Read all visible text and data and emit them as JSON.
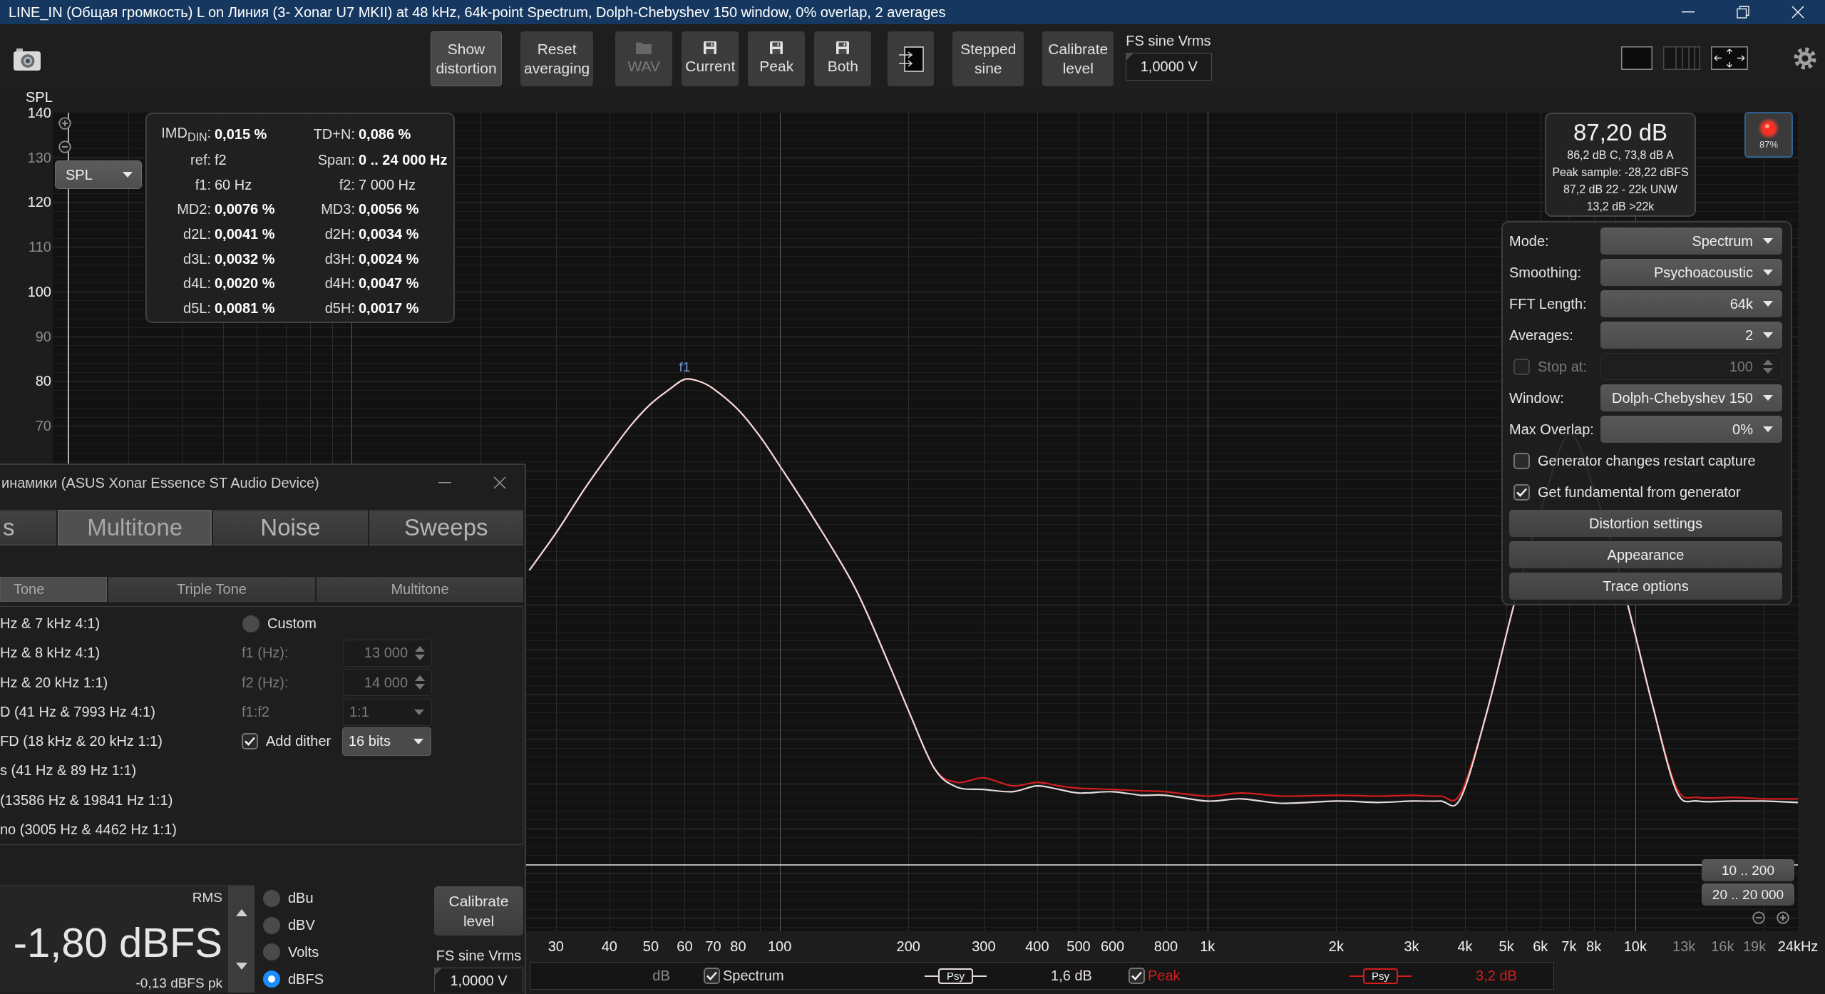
{
  "window": {
    "title": "LINE_IN (Общая громкость) L on Линия (3- Xonar U7 MKII) at 48 kHz, 64k-point Spectrum, Dolph-Chebyshev 150 window, 0% overlap, 2 averages"
  },
  "toolbar": {
    "buttons": [
      {
        "label": "Show distortion",
        "kind": "text",
        "on": true,
        "disabled": false
      },
      {
        "label": "Reset averaging",
        "kind": "text",
        "on": false,
        "disabled": false
      },
      {
        "label": "WAV",
        "kind": "open",
        "on": false,
        "disabled": true
      },
      {
        "label": "Current",
        "kind": "save",
        "on": false,
        "disabled": false
      },
      {
        "label": "Peak",
        "kind": "save",
        "on": false,
        "disabled": false
      },
      {
        "label": "Both",
        "kind": "save",
        "on": false,
        "disabled": false
      },
      {
        "kind": "import",
        "on": false,
        "disabled": false
      },
      {
        "label": "Stepped sine",
        "kind": "text",
        "on": false,
        "disabled": false
      },
      {
        "label": "Calibrate level",
        "kind": "text",
        "on": false,
        "disabled": false
      }
    ],
    "fs_sine": {
      "label": "FS sine Vrms",
      "value": "1,0000 V"
    }
  },
  "graph": {
    "y_axis": {
      "title": "SPL",
      "labels": [
        {
          "text": "140",
          "dim": false
        },
        {
          "text": "130",
          "dim": true
        },
        {
          "text": "120",
          "dim": false
        },
        {
          "text": "110",
          "dim": true
        },
        {
          "text": "100",
          "dim": false
        },
        {
          "text": "90",
          "dim": true
        },
        {
          "text": "80",
          "dim": false
        },
        {
          "text": "70",
          "dim": true
        }
      ]
    },
    "unit_dropdown": {
      "value": "SPL"
    },
    "peak_marker": {
      "label": "f1"
    },
    "x_axis": {
      "labels": [
        {
          "text": "30",
          "dim": false
        },
        {
          "text": "40",
          "dim": false
        },
        {
          "text": "50",
          "dim": false
        },
        {
          "text": "60",
          "dim": false
        },
        {
          "text": "70",
          "dim": false
        },
        {
          "text": "80",
          "dim": false
        },
        {
          "text": "100",
          "dim": false
        },
        {
          "text": "200",
          "dim": false
        },
        {
          "text": "300",
          "dim": false
        },
        {
          "text": "400",
          "dim": false
        },
        {
          "text": "500",
          "dim": false
        },
        {
          "text": "600",
          "dim": false
        },
        {
          "text": "800",
          "dim": false
        },
        {
          "text": "1k",
          "dim": false
        },
        {
          "text": "2k",
          "dim": false
        },
        {
          "text": "3k",
          "dim": false
        },
        {
          "text": "4k",
          "dim": false
        },
        {
          "text": "5k",
          "dim": false
        },
        {
          "text": "6k",
          "dim": false
        },
        {
          "text": "7k",
          "dim": false
        },
        {
          "text": "8k",
          "dim": false
        },
        {
          "text": "10k",
          "dim": false
        },
        {
          "text": "13k",
          "dim": true
        },
        {
          "text": "16k",
          "dim": true
        },
        {
          "text": "19k",
          "dim": true
        },
        {
          "text": "24kHz",
          "dim": false
        }
      ]
    },
    "x_zoom_presets": [
      "10 .. 200",
      "20 .. 20 000"
    ]
  },
  "distortion_readout": {
    "items": [
      {
        "label": "IMD$_{DIN}$:",
        "value": "0,015 %",
        "kind": "measure"
      },
      {
        "label": "TD+N:",
        "value": "0,086 %",
        "kind": "measure"
      },
      {
        "label": "ref:",
        "value": "f2",
        "kind": "param"
      },
      {
        "label": "Span:",
        "value": "0 .. 24 000 Hz",
        "kind": "measure"
      },
      {
        "label": "f1:",
        "value": "60 Hz",
        "kind": "param"
      },
      {
        "label": "f2:",
        "value": "7 000 Hz",
        "kind": "param"
      },
      {
        "label": "MD2:",
        "value": "0,0076 %",
        "kind": "measure"
      },
      {
        "label": "MD3:",
        "value": "0,0056 %",
        "kind": "measure"
      },
      {
        "label": "d2L:",
        "value": "0,0041 %",
        "kind": "measure"
      },
      {
        "label": "d2H:",
        "value": "0,0034 %",
        "kind": "measure"
      },
      {
        "label": "d3L:",
        "value": "0,0032 %",
        "kind": "measure"
      },
      {
        "label": "d3H:",
        "value": "0,0024 %",
        "kind": "measure"
      },
      {
        "label": "d4L:",
        "value": "0,0020 %",
        "kind": "measure"
      },
      {
        "label": "d4H:",
        "value": "0,0047 %",
        "kind": "measure"
      },
      {
        "label": "d5L:",
        "value": "0,0081 %",
        "kind": "measure"
      },
      {
        "label": "d5H:",
        "value": "0,0017 %",
        "kind": "measure"
      }
    ]
  },
  "level_readout": {
    "main": "87,20 dB",
    "lines": [
      "86,2 dB C, 73,8 dB A",
      "Peak sample: -28,22 dBFS",
      "87,2 dB 22 - 22k UNW",
      "13,2 dB >22k"
    ]
  },
  "record_button": {
    "label": "87%"
  },
  "rta_panel": {
    "rows": [
      {
        "kind": "dropdown",
        "label": "Mode:",
        "value": "Spectrum",
        "disabled": false
      },
      {
        "kind": "dropdown",
        "label": "Smoothing:",
        "value": "Psychoacoustic",
        "disabled": false
      },
      {
        "kind": "dropdown",
        "label": "FFT Length:",
        "value": "64k",
        "disabled": false
      },
      {
        "kind": "dropdown",
        "label": "Averages:",
        "value": "2",
        "disabled": false
      },
      {
        "kind": "check-spinner",
        "label": "Stop at:",
        "value": "100",
        "checked": false,
        "disabled": true
      },
      {
        "kind": "dropdown",
        "label": "Window:",
        "value": "Dolph-Chebyshev 150",
        "disabled": false
      },
      {
        "kind": "dropdown",
        "label": "Max Overlap:",
        "value": "0%",
        "disabled": false
      },
      {
        "kind": "checkbox",
        "label": "Generator changes restart capture",
        "checked": false,
        "disabled": false
      },
      {
        "kind": "checkbox",
        "label": "Get fundamental from generator",
        "checked": true,
        "disabled": false
      },
      {
        "kind": "button",
        "label": "Distortion settings",
        "disabled": false
      },
      {
        "kind": "button",
        "label": "Appearance",
        "disabled": false
      },
      {
        "kind": "button",
        "label": "Trace options",
        "disabled": false
      }
    ]
  },
  "generator": {
    "title": "инамики (ASUS Xonar Essence ST Audio Device)",
    "tabs": [
      {
        "label": "s",
        "selected": false
      },
      {
        "label": "Multitone",
        "selected": true
      },
      {
        "label": "Noise",
        "selected": false
      },
      {
        "label": "Sweeps",
        "selected": false
      }
    ],
    "subtabs": [
      {
        "label": "Tone",
        "selected": true
      },
      {
        "label": "Triple Tone",
        "selected": false
      },
      {
        "label": "Multitone",
        "selected": false
      }
    ],
    "presets": [
      "Hz & 7 kHz 4:1)",
      "Hz & 8 kHz 4:1)",
      "Hz & 20 kHz 1:1)",
      "D (41 Hz & 7993 Hz 4:1)",
      "FD (18 kHz & 20 kHz 1:1)",
      "s (41 Hz & 89 Hz 1:1)",
      "(13586 Hz & 19841 Hz 1:1)",
      "no (3005 Hz & 4462 Hz 1:1)"
    ],
    "custom": {
      "label": "Custom",
      "selected": false
    },
    "fields": [
      {
        "kind": "spinner",
        "label": "f1 (Hz):",
        "value": "13 000",
        "disabled": true
      },
      {
        "kind": "spinner",
        "label": "f2 (Hz):",
        "value": "14 000",
        "disabled": true
      },
      {
        "kind": "dropdown",
        "label": "f1:f2",
        "value": "1:1",
        "disabled": true
      }
    ],
    "dither": {
      "label": "Add dither",
      "checked": true,
      "value": "16 bits"
    },
    "level": {
      "caption": "RMS",
      "value": "-1,80 dBFS",
      "peak": "-0,13 dBFS pk"
    },
    "units": [
      {
        "label": "dBu",
        "selected": false
      },
      {
        "label": "dBV",
        "selected": false
      },
      {
        "label": "Volts",
        "selected": false
      },
      {
        "label": "dBFS",
        "selected": true
      }
    ],
    "calibrate_button": "Calibrate level",
    "fs_sine": {
      "label": "FS sine Vrms",
      "value": "1,0000 V"
    }
  },
  "legend": {
    "unit": "dB",
    "traces": [
      {
        "name": "Spectrum",
        "checked": true,
        "color": "#e6dcdc",
        "smoothing": "Psy",
        "offset": "1,6 dB"
      },
      {
        "name": "Peak",
        "checked": true,
        "color": "#d41c1c",
        "smoothing": "Psy",
        "offset": "3,2 dB"
      }
    ]
  }
}
